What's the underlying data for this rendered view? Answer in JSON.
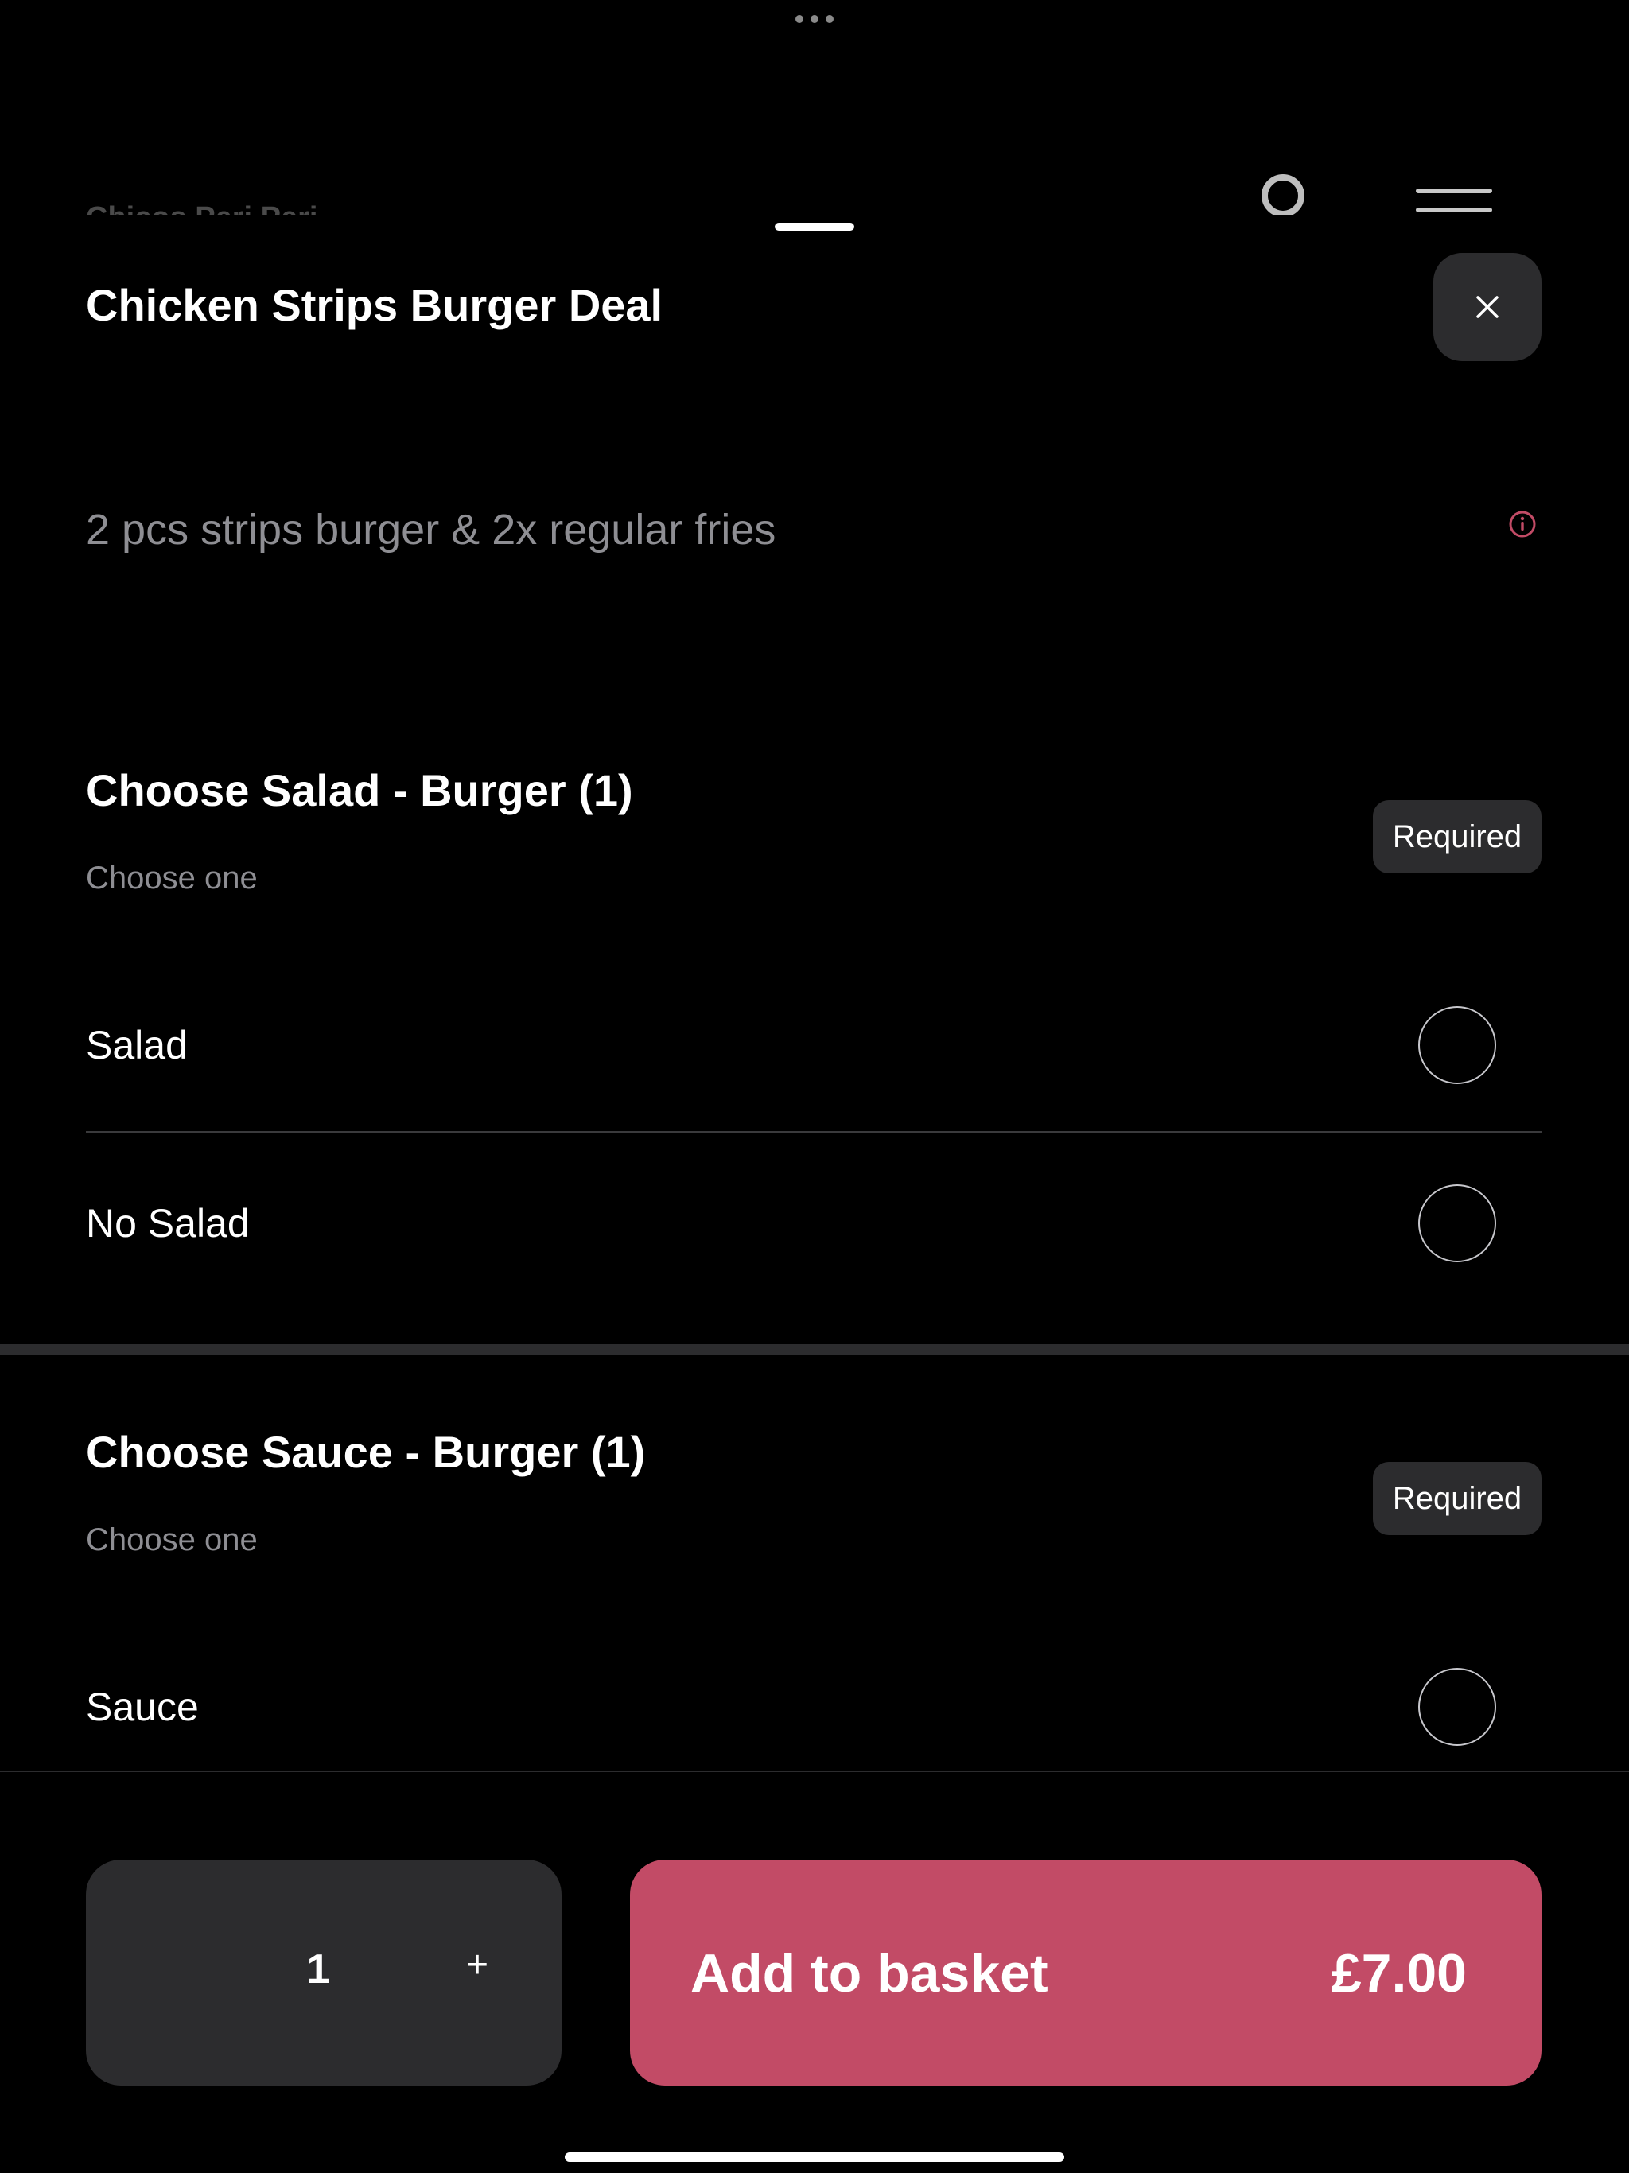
{
  "background_page": {
    "title": "Chicos Peri Peri"
  },
  "item": {
    "title": "Chicken Strips Burger Deal",
    "description": "2 pcs strips burger & 2x regular fries"
  },
  "sections": [
    {
      "title": "Choose Salad - Burger (1)",
      "subtitle": "Choose one",
      "badge": "Required",
      "options": [
        {
          "label": "Salad",
          "selected": false
        },
        {
          "label": "No Salad",
          "selected": false
        }
      ]
    },
    {
      "title": "Choose Sauce - Burger (1)",
      "subtitle": "Choose one",
      "badge": "Required",
      "options": [
        {
          "label": "Sauce",
          "selected": false
        }
      ]
    }
  ],
  "footer": {
    "quantity": "1",
    "plus_symbol": "+",
    "add_label": "Add to basket",
    "price": "£7.00"
  },
  "icons": {
    "close": "close-icon",
    "info": "info-icon",
    "loader": "loading-icon",
    "menu": "menu-icon"
  },
  "colors": {
    "accent": "#c24b66",
    "surface": "#2c2c2e",
    "background": "#000000",
    "secondary_text": "#8e8e93"
  }
}
